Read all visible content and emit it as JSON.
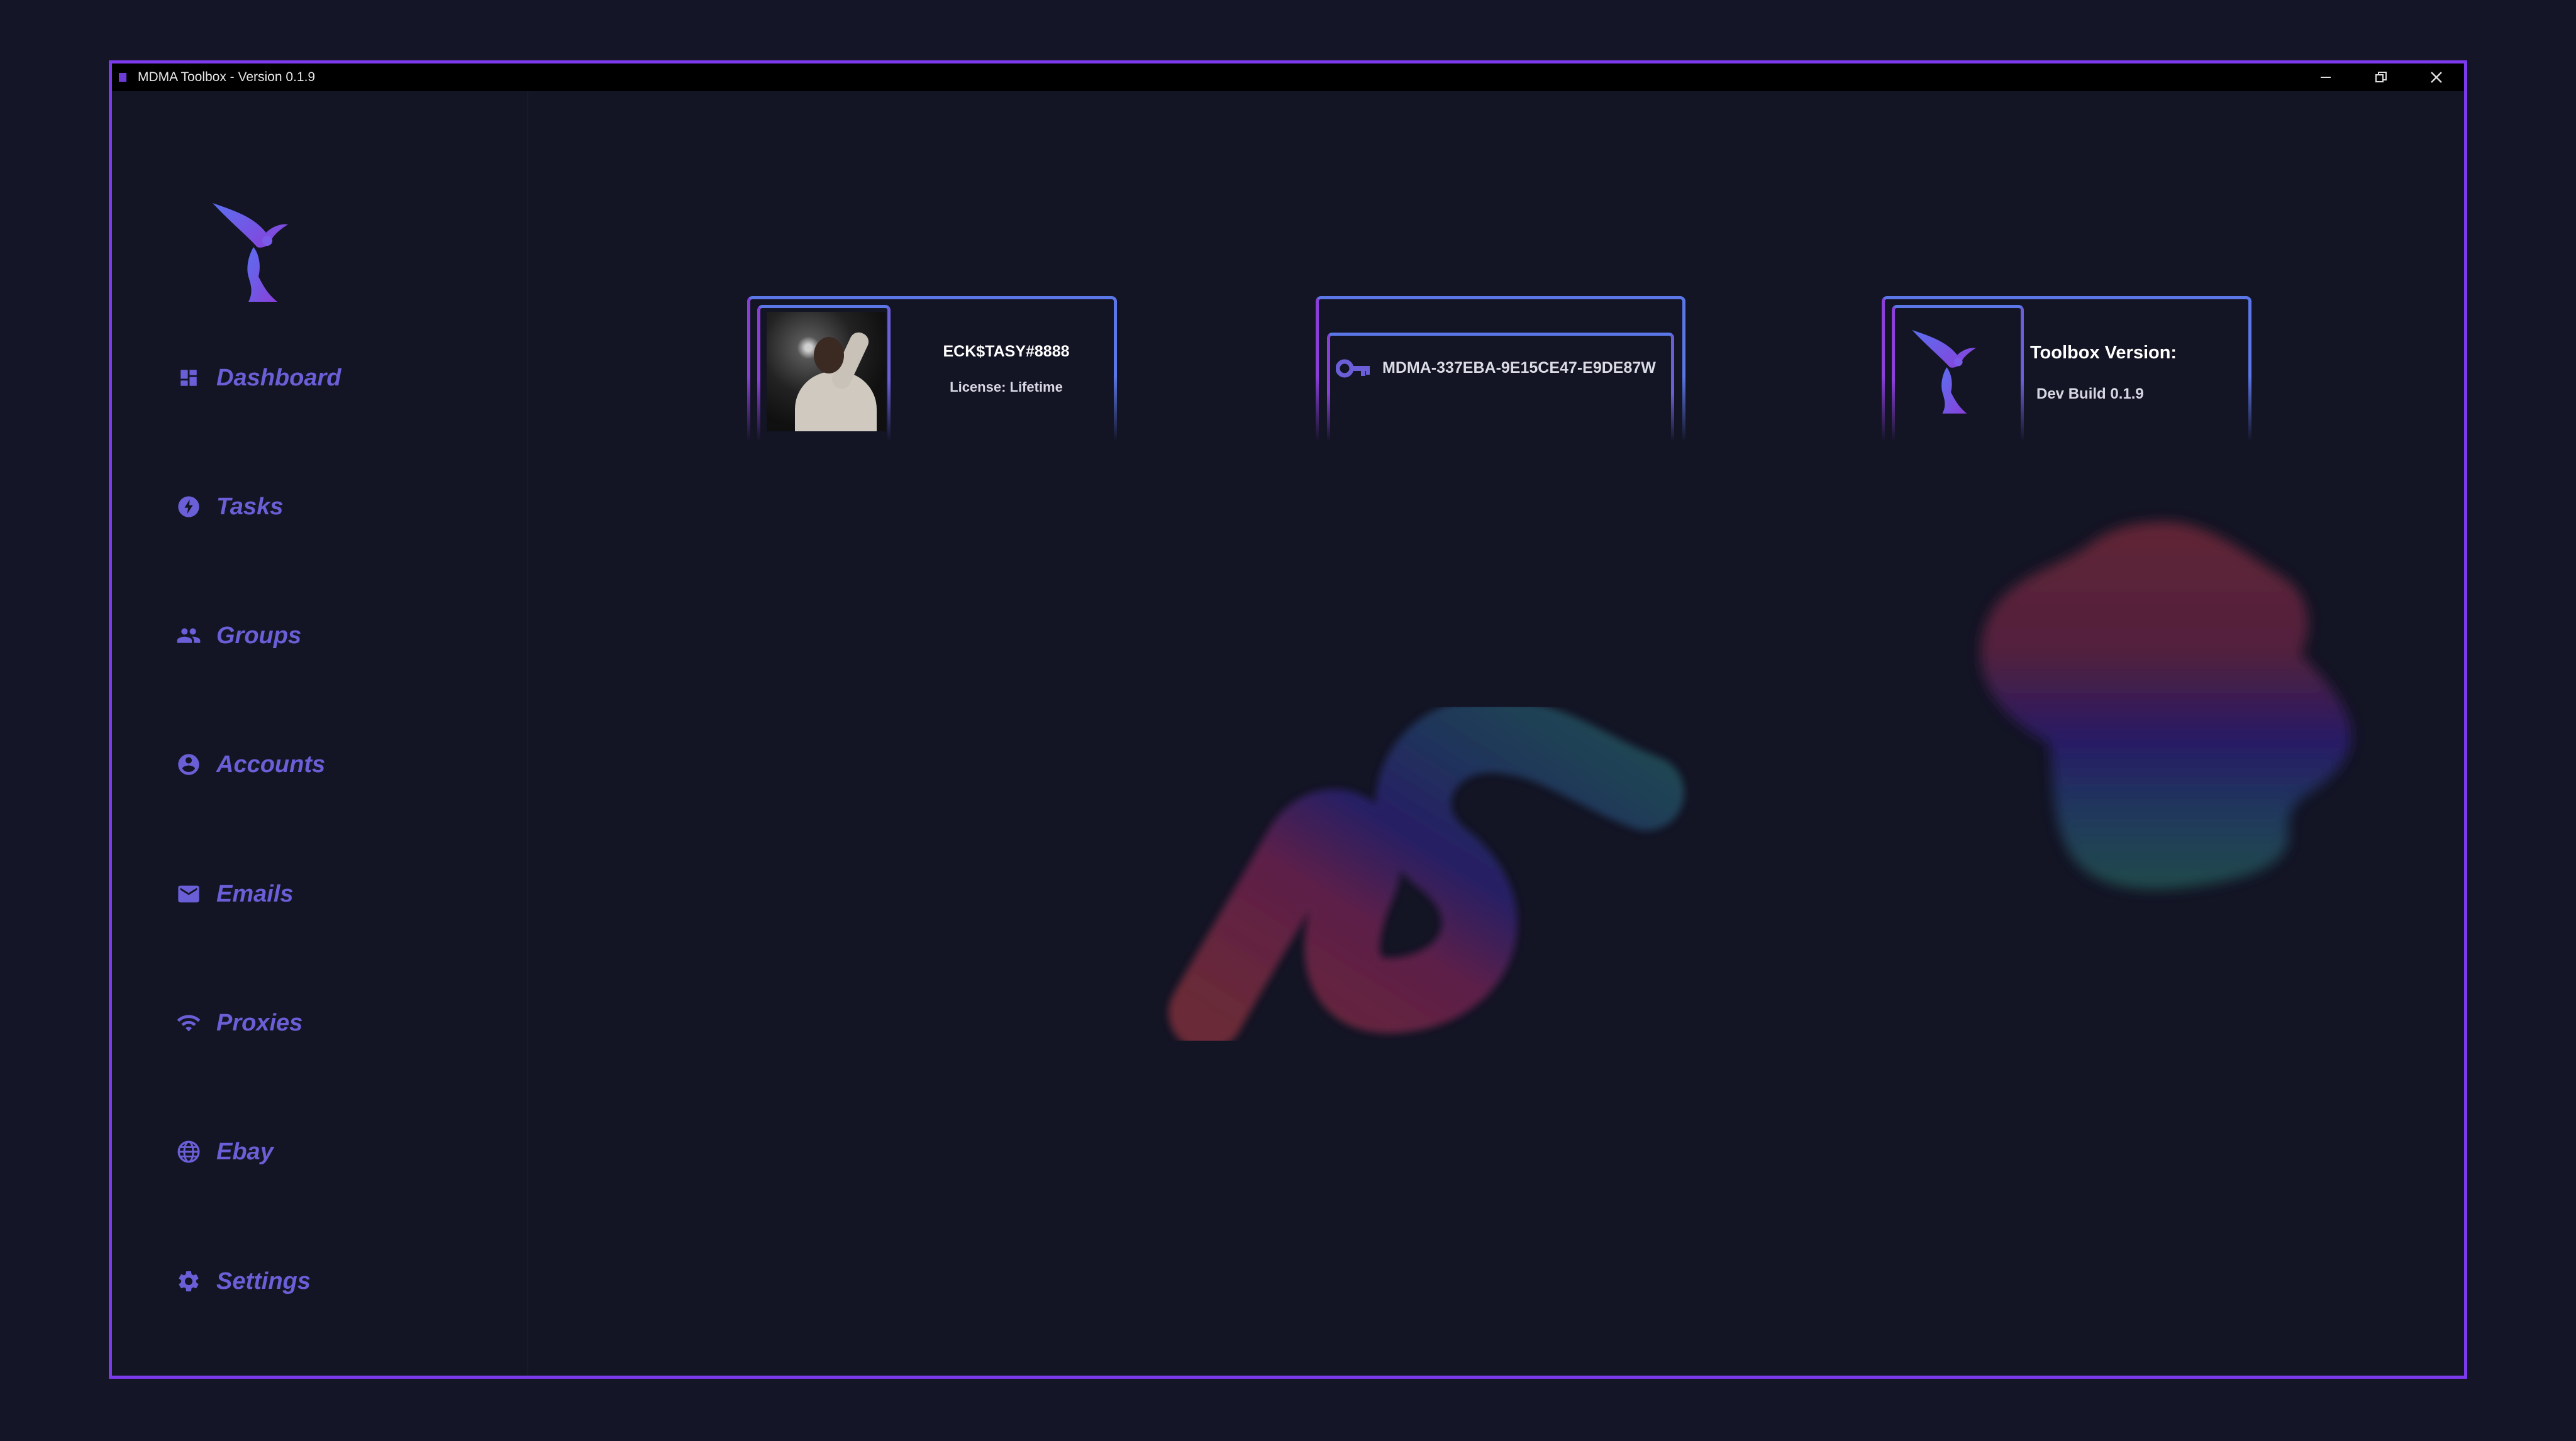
{
  "window": {
    "title": "MDMA Toolbox - Version 0.1.9",
    "controls": [
      "minimize",
      "restore",
      "close"
    ]
  },
  "sidebar": {
    "logo": "winged-figure-logo",
    "items": [
      {
        "label": "Dashboard",
        "icon": "dashboard-icon"
      },
      {
        "label": "Tasks",
        "icon": "bolt-icon"
      },
      {
        "label": "Groups",
        "icon": "people-icon"
      },
      {
        "label": "Accounts",
        "icon": "account-circle-icon"
      },
      {
        "label": "Emails",
        "icon": "mail-icon"
      },
      {
        "label": "Proxies",
        "icon": "wifi-icon"
      },
      {
        "label": "Ebay",
        "icon": "globe-icon"
      },
      {
        "label": "Settings",
        "icon": "gear-icon"
      }
    ]
  },
  "cards": {
    "user": {
      "name": "ECK$TASY#8888",
      "license": "License: Lifetime"
    },
    "key": {
      "value": "MDMA-337EBA-9E15CE47-E9DE87W",
      "icon": "key-icon"
    },
    "version": {
      "title": "Toolbox Version:",
      "value": "Dev Build 0.1.9"
    }
  },
  "colors": {
    "accent": "#7c3aed",
    "nav_text": "#6a5fd6",
    "background": "#131424",
    "card_border_blue": "#5b76e6",
    "card_border_purple": "#8a3fd9"
  }
}
